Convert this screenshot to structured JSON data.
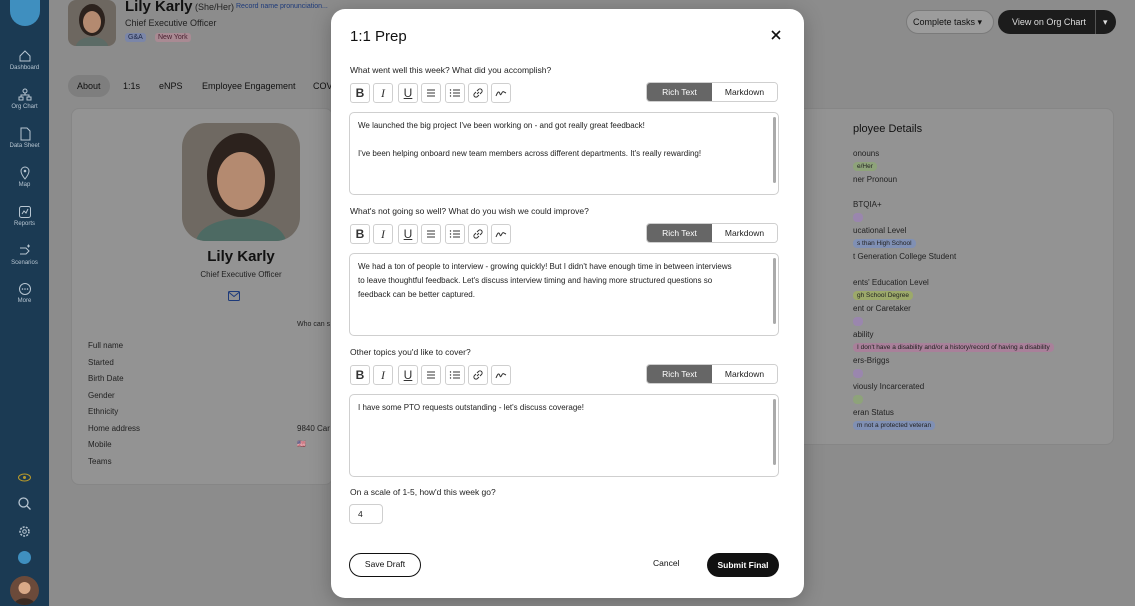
{
  "sidebar": {
    "items": [
      {
        "label": "Dashboard",
        "icon": "home-icon"
      },
      {
        "label": "Org Chart",
        "icon": "org-chart-icon"
      },
      {
        "label": "Data Sheet",
        "icon": "document-icon"
      },
      {
        "label": "Map",
        "icon": "map-pin-icon"
      },
      {
        "label": "Reports",
        "icon": "reports-icon"
      },
      {
        "label": "Scenarios",
        "icon": "scenarios-icon"
      },
      {
        "label": "More",
        "icon": "more-icon"
      }
    ]
  },
  "header": {
    "name": "Lily Karly",
    "pronoun": "(She/Her)",
    "pronunciation_link": "Record name pronunciation...",
    "title": "Chief Executive Officer",
    "tags": [
      "G&A",
      "New York"
    ],
    "complete_tasks": "Complete tasks",
    "view_org_chart": "View on Org Chart"
  },
  "tabs": [
    "About",
    "1:1s",
    "eNPS",
    "Employee Engagement",
    "COV"
  ],
  "profile": {
    "name": "Lily Karly",
    "title": "Chief Executive Officer",
    "who_can_see": "Who can s",
    "fields": [
      "Full name",
      "Started",
      "Birth Date",
      "Gender",
      "Ethnicity",
      "Home address",
      "Mobile",
      "Teams"
    ],
    "home_address_value": "9840 Car"
  },
  "details": {
    "title": "ployee Details",
    "rows": [
      {
        "label": "onouns",
        "badge": "e/Her"
      },
      {
        "label": "ner Pronoun",
        "badge": ""
      },
      {
        "label": "BTQIA+",
        "badge": ""
      },
      {
        "label": "ucational Level",
        "badge": "s than High School"
      },
      {
        "label": "t Generation College Student",
        "badge": ""
      },
      {
        "label": "ents' Education Level",
        "badge": "gh School Degree"
      },
      {
        "label": "ent or Caretaker",
        "badge": ""
      },
      {
        "label": "ability",
        "badge": "I don't have a disability and/or a history/record of having a disability"
      },
      {
        "label": "ers-Briggs",
        "badge": ""
      },
      {
        "label": "viously Incarcerated",
        "badge": ""
      },
      {
        "label": "eran Status",
        "badge": "m not a protected veteran"
      }
    ]
  },
  "modal": {
    "title": "1:1 Prep",
    "mode_rich": "Rich Text",
    "mode_markdown": "Markdown",
    "questions": [
      {
        "label": "What went well this week? What did you accomplish?",
        "lines": [
          "We launched the big project I've been working on - and got really great feedback!",
          "",
          "I've been helping onboard new team members across different departments. It's really rewarding!"
        ]
      },
      {
        "label": "What's not going so well? What do you wish we could improve?",
        "lines": [
          "We had a ton of people to interview - growing quickly! But I didn't have enough time in between interviews",
          "to leave thoughtful feedback.  Let's discuss interview timing and having more structured questions so",
          "feedback can be better captured."
        ]
      },
      {
        "label": "Other topics you'd like to cover?",
        "lines": [
          "I have some PTO requests outstanding - let's discuss coverage!"
        ]
      }
    ],
    "scale_label": "On a scale of 1-5, how'd this week go?",
    "scale_value": "4",
    "save_draft": "Save Draft",
    "cancel": "Cancel",
    "submit": "Submit Final"
  }
}
